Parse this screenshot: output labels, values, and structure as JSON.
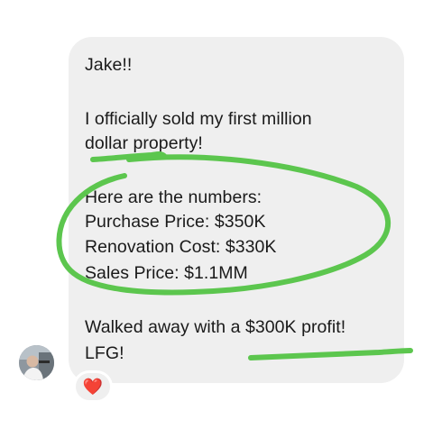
{
  "message": {
    "lines": [
      "Jake!!",
      "I officially sold my first million",
      "dollar property!",
      "Here are the numbers:",
      "Purchase Price: $350K",
      "Renovation Cost: $330K",
      "Sales Price: $1.1MM",
      "Walked away with a $300K profit!",
      "LFG!"
    ]
  },
  "reaction": {
    "emoji": "❤️",
    "icon": "red-heart-icon"
  },
  "sender": {
    "avatar_icon": "profile-photo"
  },
  "colors": {
    "bubble": "#efefef",
    "text": "#1a1a1a",
    "annotation": "#5cc64e",
    "heart": "#e8233b"
  }
}
